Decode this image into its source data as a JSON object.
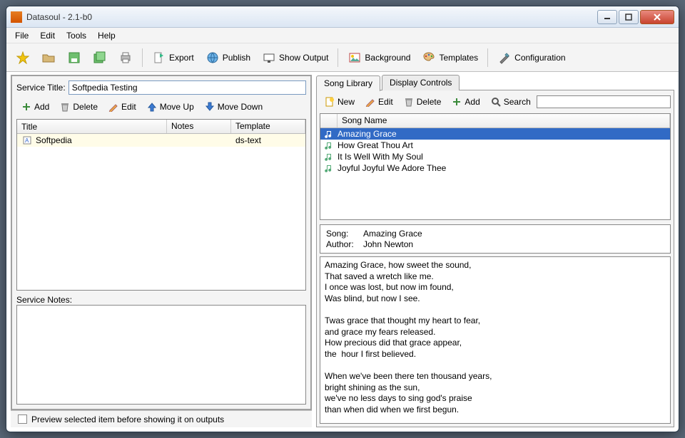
{
  "window": {
    "title": "Datasoul - 2.1-b0"
  },
  "menubar": [
    "File",
    "Edit",
    "Tools",
    "Help"
  ],
  "toolbar": {
    "export": "Export",
    "publish": "Publish",
    "show_output": "Show Output",
    "background": "Background",
    "templates": "Templates",
    "configuration": "Configuration"
  },
  "service": {
    "title_label": "Service Title:",
    "title_value": "Softpedia Testing",
    "buttons": {
      "add": "Add",
      "delete": "Delete",
      "edit": "Edit",
      "moveup": "Move Up",
      "movedown": "Move Down"
    },
    "columns": {
      "title": "Title",
      "notes": "Notes",
      "template": "Template"
    },
    "rows": [
      {
        "title": "Softpedia",
        "notes": "",
        "template": "ds-text"
      }
    ],
    "notes_label": "Service Notes:"
  },
  "footer": {
    "preview_label": "Preview selected item before showing it on outputs"
  },
  "tabs": {
    "library": "Song Library",
    "controls": "Display Controls",
    "active": "library"
  },
  "songtoolbar": {
    "new": "New",
    "edit": "Edit",
    "delete": "Delete",
    "add": "Add",
    "search": "Search"
  },
  "songlist": {
    "header": "Song Name",
    "items": [
      {
        "name": "Amazing Grace",
        "selected": true
      },
      {
        "name": "How Great Thou Art",
        "selected": false
      },
      {
        "name": "It Is Well With My Soul",
        "selected": false
      },
      {
        "name": "Joyful Joyful We Adore Thee",
        "selected": false
      }
    ]
  },
  "songmeta": {
    "song_label": "Song:",
    "song_value": "Amazing Grace",
    "author_label": "Author:",
    "author_value": "John Newton"
  },
  "lyrics": "Amazing Grace, how sweet the sound,\nThat saved a wretch like me.\nI once was lost, but now im found,\nWas blind, but now I see.\n\nTwas grace that thought my heart to fear,\nand grace my fears released.\nHow precious did that grace appear,\nthe  hour I first believed.\n\nWhen we've been there ten thousand years,\nbright shining as the sun,\nwe've no less days to sing god's praise\nthan when did when we first begun."
}
